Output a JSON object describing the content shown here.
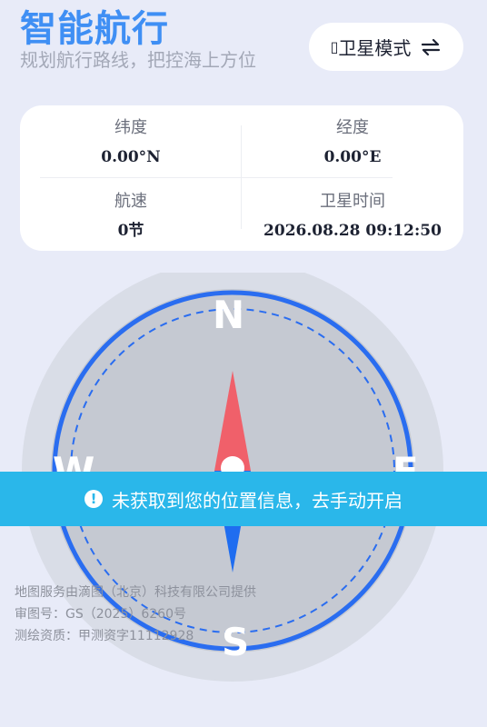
{
  "header": {
    "title": "智能航行",
    "subtitle": "规划航行路线，把控海上方位"
  },
  "mode_button": {
    "box_glyph": "▯",
    "label": "卫星模式",
    "icon": "swap-arrows-icon"
  },
  "info": {
    "latitude": {
      "label": "纬度",
      "value": "0.00°N"
    },
    "longitude": {
      "label": "经度",
      "value": "0.00°E"
    },
    "speed": {
      "label": "航速",
      "value": "0节"
    },
    "satellite_time": {
      "label": "卫星时间",
      "value": "2026.08.28 09:12:50"
    }
  },
  "compass": {
    "north": "N",
    "south": "S",
    "west": "W",
    "east": "E",
    "needle_colors": {
      "north": "#f0606a",
      "south": "#1f6df0"
    },
    "ring_color": "#2a6df0"
  },
  "toast": {
    "icon": "exclamation-icon",
    "text": "未获取到您的位置信息，去手动开启"
  },
  "map_credits": {
    "line1": "地图服务由滴图（北京）科技有限公司提供",
    "line2": "审图号：GS（2025）6260号",
    "line3": "测绘资质：甲测资字11112928"
  }
}
